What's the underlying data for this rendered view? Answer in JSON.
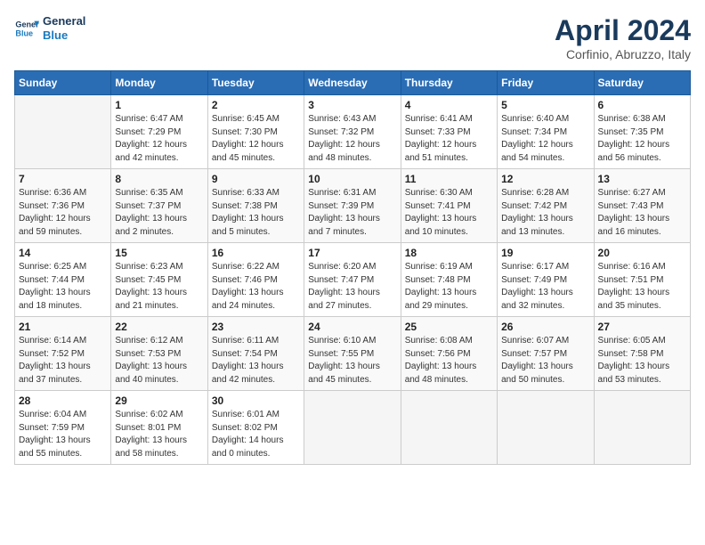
{
  "header": {
    "logo_line1": "General",
    "logo_line2": "Blue",
    "month": "April 2024",
    "location": "Corfinio, Abruzzo, Italy"
  },
  "weekdays": [
    "Sunday",
    "Monday",
    "Tuesday",
    "Wednesday",
    "Thursday",
    "Friday",
    "Saturday"
  ],
  "weeks": [
    [
      {
        "day": "",
        "info": ""
      },
      {
        "day": "1",
        "info": "Sunrise: 6:47 AM\nSunset: 7:29 PM\nDaylight: 12 hours\nand 42 minutes."
      },
      {
        "day": "2",
        "info": "Sunrise: 6:45 AM\nSunset: 7:30 PM\nDaylight: 12 hours\nand 45 minutes."
      },
      {
        "day": "3",
        "info": "Sunrise: 6:43 AM\nSunset: 7:32 PM\nDaylight: 12 hours\nand 48 minutes."
      },
      {
        "day": "4",
        "info": "Sunrise: 6:41 AM\nSunset: 7:33 PM\nDaylight: 12 hours\nand 51 minutes."
      },
      {
        "day": "5",
        "info": "Sunrise: 6:40 AM\nSunset: 7:34 PM\nDaylight: 12 hours\nand 54 minutes."
      },
      {
        "day": "6",
        "info": "Sunrise: 6:38 AM\nSunset: 7:35 PM\nDaylight: 12 hours\nand 56 minutes."
      }
    ],
    [
      {
        "day": "7",
        "info": "Sunrise: 6:36 AM\nSunset: 7:36 PM\nDaylight: 12 hours\nand 59 minutes."
      },
      {
        "day": "8",
        "info": "Sunrise: 6:35 AM\nSunset: 7:37 PM\nDaylight: 13 hours\nand 2 minutes."
      },
      {
        "day": "9",
        "info": "Sunrise: 6:33 AM\nSunset: 7:38 PM\nDaylight: 13 hours\nand 5 minutes."
      },
      {
        "day": "10",
        "info": "Sunrise: 6:31 AM\nSunset: 7:39 PM\nDaylight: 13 hours\nand 7 minutes."
      },
      {
        "day": "11",
        "info": "Sunrise: 6:30 AM\nSunset: 7:41 PM\nDaylight: 13 hours\nand 10 minutes."
      },
      {
        "day": "12",
        "info": "Sunrise: 6:28 AM\nSunset: 7:42 PM\nDaylight: 13 hours\nand 13 minutes."
      },
      {
        "day": "13",
        "info": "Sunrise: 6:27 AM\nSunset: 7:43 PM\nDaylight: 13 hours\nand 16 minutes."
      }
    ],
    [
      {
        "day": "14",
        "info": "Sunrise: 6:25 AM\nSunset: 7:44 PM\nDaylight: 13 hours\nand 18 minutes."
      },
      {
        "day": "15",
        "info": "Sunrise: 6:23 AM\nSunset: 7:45 PM\nDaylight: 13 hours\nand 21 minutes."
      },
      {
        "day": "16",
        "info": "Sunrise: 6:22 AM\nSunset: 7:46 PM\nDaylight: 13 hours\nand 24 minutes."
      },
      {
        "day": "17",
        "info": "Sunrise: 6:20 AM\nSunset: 7:47 PM\nDaylight: 13 hours\nand 27 minutes."
      },
      {
        "day": "18",
        "info": "Sunrise: 6:19 AM\nSunset: 7:48 PM\nDaylight: 13 hours\nand 29 minutes."
      },
      {
        "day": "19",
        "info": "Sunrise: 6:17 AM\nSunset: 7:49 PM\nDaylight: 13 hours\nand 32 minutes."
      },
      {
        "day": "20",
        "info": "Sunrise: 6:16 AM\nSunset: 7:51 PM\nDaylight: 13 hours\nand 35 minutes."
      }
    ],
    [
      {
        "day": "21",
        "info": "Sunrise: 6:14 AM\nSunset: 7:52 PM\nDaylight: 13 hours\nand 37 minutes."
      },
      {
        "day": "22",
        "info": "Sunrise: 6:12 AM\nSunset: 7:53 PM\nDaylight: 13 hours\nand 40 minutes."
      },
      {
        "day": "23",
        "info": "Sunrise: 6:11 AM\nSunset: 7:54 PM\nDaylight: 13 hours\nand 42 minutes."
      },
      {
        "day": "24",
        "info": "Sunrise: 6:10 AM\nSunset: 7:55 PM\nDaylight: 13 hours\nand 45 minutes."
      },
      {
        "day": "25",
        "info": "Sunrise: 6:08 AM\nSunset: 7:56 PM\nDaylight: 13 hours\nand 48 minutes."
      },
      {
        "day": "26",
        "info": "Sunrise: 6:07 AM\nSunset: 7:57 PM\nDaylight: 13 hours\nand 50 minutes."
      },
      {
        "day": "27",
        "info": "Sunrise: 6:05 AM\nSunset: 7:58 PM\nDaylight: 13 hours\nand 53 minutes."
      }
    ],
    [
      {
        "day": "28",
        "info": "Sunrise: 6:04 AM\nSunset: 7:59 PM\nDaylight: 13 hours\nand 55 minutes."
      },
      {
        "day": "29",
        "info": "Sunrise: 6:02 AM\nSunset: 8:01 PM\nDaylight: 13 hours\nand 58 minutes."
      },
      {
        "day": "30",
        "info": "Sunrise: 6:01 AM\nSunset: 8:02 PM\nDaylight: 14 hours\nand 0 minutes."
      },
      {
        "day": "",
        "info": ""
      },
      {
        "day": "",
        "info": ""
      },
      {
        "day": "",
        "info": ""
      },
      {
        "day": "",
        "info": ""
      }
    ]
  ]
}
